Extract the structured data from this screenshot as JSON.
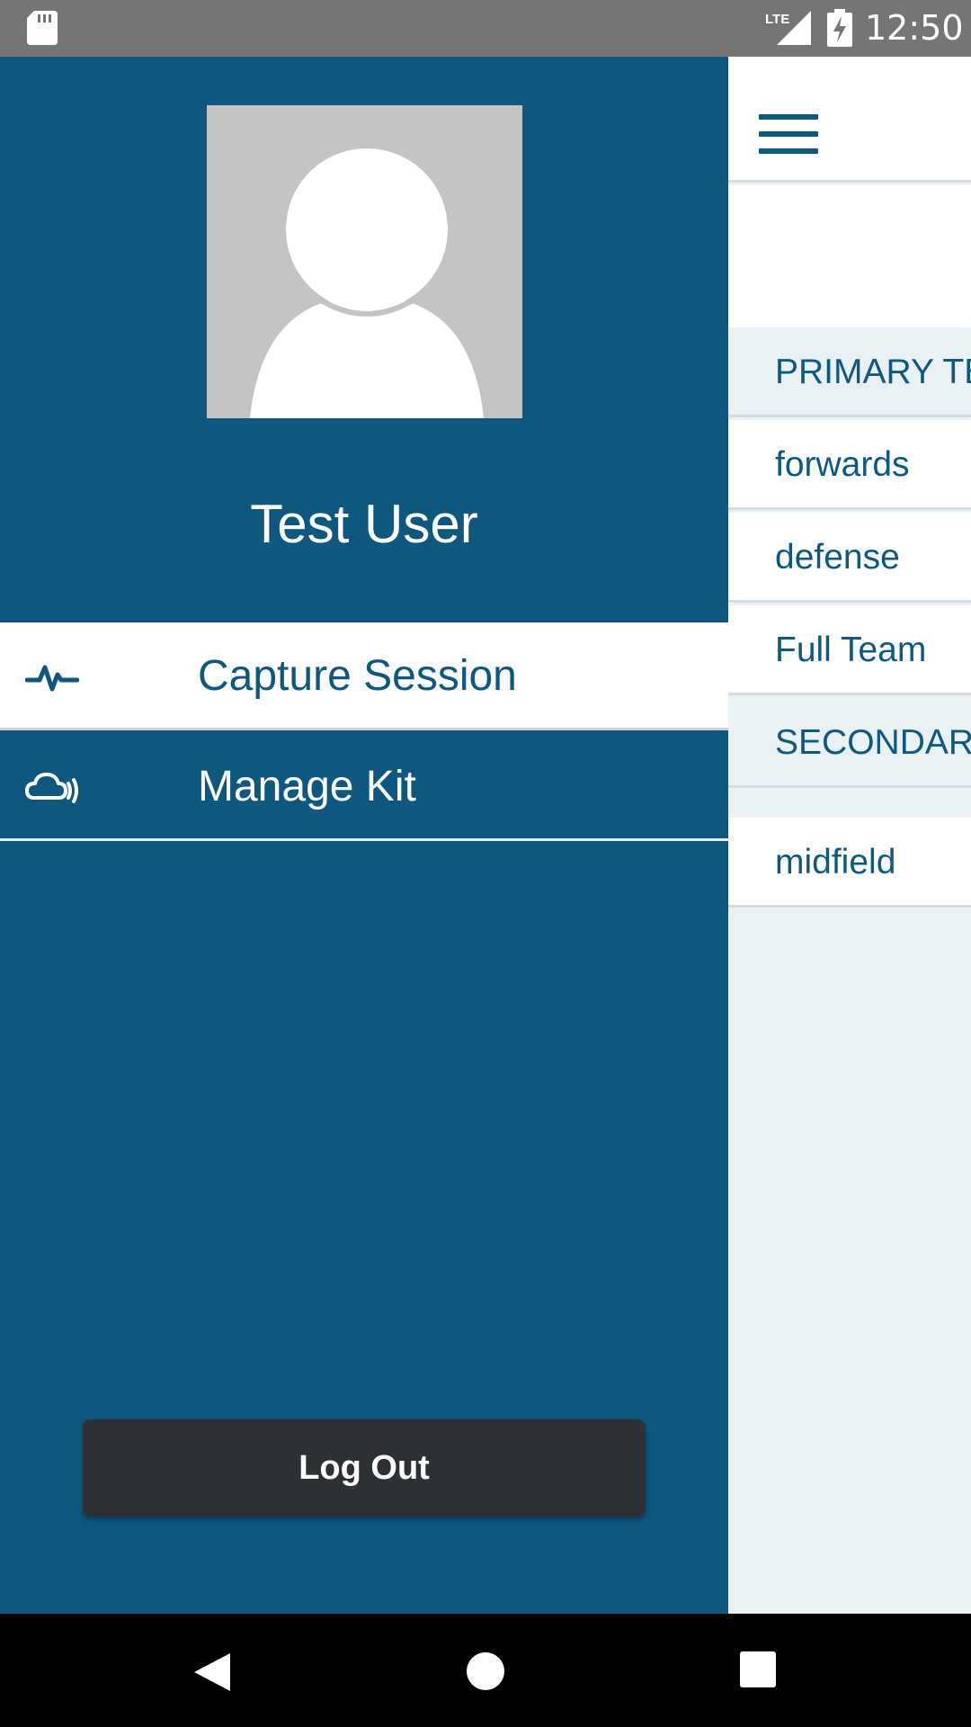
{
  "status_bar": {
    "time": "12:50",
    "network": "LTE",
    "icons": [
      "sd-card-icon",
      "lte-signal-icon",
      "battery-charging-icon"
    ]
  },
  "drawer": {
    "user_name": "Test User",
    "items": [
      {
        "label": "Capture Session",
        "icon": "activity-pulse-icon",
        "active": true
      },
      {
        "label": "Manage Kit",
        "icon": "cloud-wireless-icon",
        "active": false
      }
    ],
    "logout_label": "Log Out"
  },
  "background_screen": {
    "rows": [
      {
        "type": "header",
        "label": "PRIMARY TEAMS"
      },
      {
        "type": "item",
        "label": "forwards"
      },
      {
        "type": "item",
        "label": "defense"
      },
      {
        "type": "item",
        "label": "Full Team"
      },
      {
        "type": "header",
        "label": "SECONDARY TEAMS"
      },
      {
        "type": "item",
        "label": "midfield"
      }
    ]
  },
  "colors": {
    "drawer_bg": "#0e587f",
    "accent": "#0d5a7f",
    "logout_bg": "#2d3136",
    "page_bg": "#eaf1f5"
  }
}
